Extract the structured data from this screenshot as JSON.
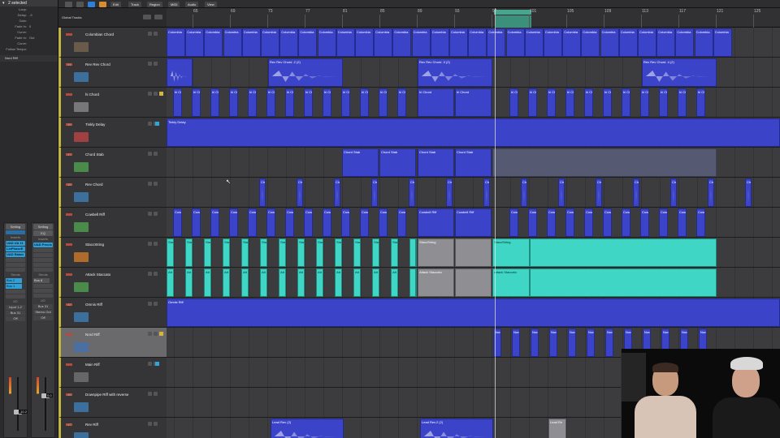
{
  "inspector": {
    "header": "2 selected",
    "rows": [
      {
        "k": "Loop:",
        "v": ""
      },
      {
        "k": "Delay:",
        "v": "-3"
      },
      {
        "k": "Gain:",
        "v": ""
      },
      {
        "k": "Fade In:",
        "v": "0"
      },
      {
        "k": "Curve:",
        "v": ""
      },
      {
        "k": "Fade In:",
        "v": "Out"
      },
      {
        "k": "Curve:",
        "v": ""
      },
      {
        "k": "Follow Tempo:",
        "v": ""
      }
    ],
    "section": "Nord Riff",
    "strip_left": {
      "setting": "Setting",
      "inserts_label": "Inserts",
      "plugins": [
        "UAD UA 11",
        "LinPhaseE",
        "UAD Ratan"
      ],
      "sends_label": "Sends",
      "sends": [
        "Bus 2",
        "Bus 1"
      ],
      "io_label": "I/O",
      "input": "Input 1-2",
      "output": "Bus 31",
      "off": "Off",
      "gain": "-10.2"
    },
    "strip_right": {
      "setting": "Setting",
      "eq": "EQ",
      "inserts_label": "Inserts",
      "plugins": [
        "UAD Precis"
      ],
      "sends_label": "Sends",
      "sends": [
        "Bus 8"
      ],
      "io_label": "I/O",
      "input": "Bus 31",
      "output": "Stereo Out",
      "off": "Off",
      "gain": "0.0"
    }
  },
  "menubar": [
    "Edit",
    "Track",
    "Region",
    "MIDI",
    "Audio",
    "View"
  ],
  "global_tracks": "Global Tracks",
  "ruler": [
    "65",
    "69",
    "73",
    "77",
    "81",
    "85",
    "89",
    "93",
    "97",
    "101",
    "105",
    "109",
    "113",
    "117",
    "121",
    "125"
  ],
  "tracks": [
    {
      "num": "",
      "name": "Colombian Chord"
    },
    {
      "num": "34",
      "name": "Rev Rev Chord"
    },
    {
      "num": "",
      "name": "hi Chord"
    },
    {
      "num": "36",
      "name": "Tinkly Delay"
    },
    {
      "num": "37",
      "name": "Chord Stab"
    },
    {
      "num": "38",
      "name": "Rev Chord"
    },
    {
      "num": "",
      "name": "Cowbell Riff"
    },
    {
      "num": "",
      "name": "StaccString"
    },
    {
      "num": "",
      "name": "Attack Staccato"
    },
    {
      "num": "42",
      "name": "Omnis Riff"
    },
    {
      "num": "",
      "name": "Nord Riff"
    },
    {
      "num": "",
      "name": "Main Riff"
    },
    {
      "num": "46",
      "name": "Downpipe Riff with reverse"
    },
    {
      "num": "47",
      "name": "Rev Riff"
    }
  ],
  "regions": {
    "colombian": "Colombian Chord",
    "colombian_short": "Colombia",
    "rev_rev_2": "Rev Rev Chord .2 (2)",
    "rev_rev_3": "Rev Rev Chord .3 (2)",
    "rev_rev_4": "Rev Rev Chord .4 (2)",
    "hi": "hi Chord",
    "tinkly": "Tinkly Delay",
    "stab": "Chord Stab",
    "rev": "Ch",
    "cowbell": "Cowbell Riff",
    "cow_short": "Cow",
    "stacc": "StaccString",
    "stacc_short": "Sta",
    "attack": "Attack Staccato",
    "att_short": "Att",
    "omnis": "Omnis Riff",
    "nord": "Nord",
    "lead_rev_2": "Lead Rev (2)",
    "lead_rev_2b": "Lead Rev.2 (2)",
    "lead_rev": "Lead Re"
  }
}
